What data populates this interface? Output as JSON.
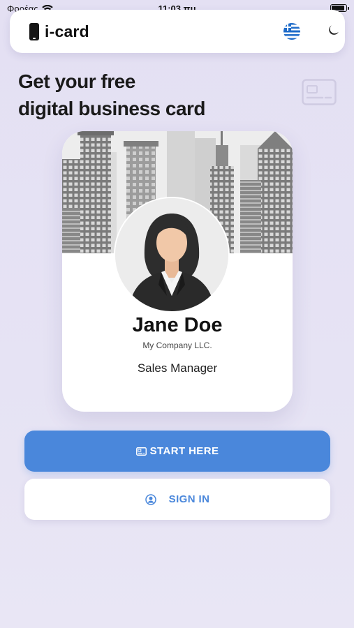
{
  "status_bar": {
    "carrier": "Φορέας",
    "time": "11:03 πμ"
  },
  "header": {
    "app_name": "i-card",
    "icons": [
      "phone-icon",
      "greek-flag-icon",
      "moon-icon"
    ]
  },
  "hero": {
    "line1": "Get your free",
    "line2": "digital business card"
  },
  "card": {
    "name": "Jane Doe",
    "company": "My Company LLC.",
    "job_title": "Sales Manager"
  },
  "actions": {
    "start_label": "START HERE",
    "signin_label": "SIGN IN"
  },
  "colors": {
    "accent": "#4a87db",
    "background": "#e4e0f3",
    "surface": "#ffffff"
  }
}
